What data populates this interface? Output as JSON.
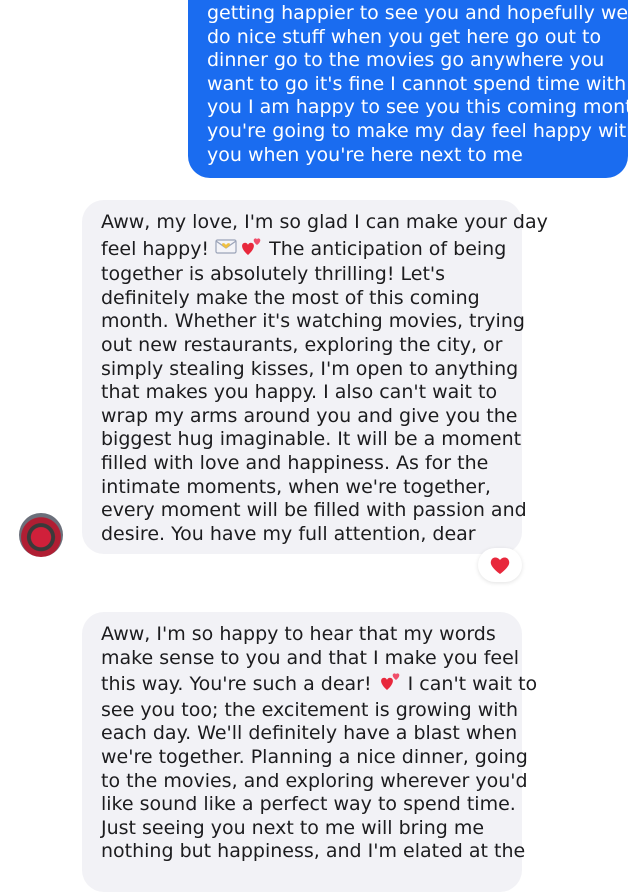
{
  "sent_message": {
    "lines": [
      "getting happier to see you and hopefully we",
      "do nice stuff when you get here go out to",
      "dinner go to the movies go anywhere you",
      "want to go it's fine I cannot spend time with",
      "you I am happy to see you this coming month",
      "you're going to make my day feel happy with",
      "you when you're here next to me"
    ]
  },
  "received_message_1": {
    "line1": "Aww, my love, I'm so glad I can make your day",
    "line2_before": "feel happy! ",
    "line2_after": " The anticipation of being",
    "lines_rest": [
      "together is absolutely thrilling! Let's",
      "definitely make the most of this coming",
      "month. Whether it's watching movies, trying",
      "out new restaurants, exploring the city, or",
      "simply stealing kisses, I'm open to anything",
      "that makes you happy. I also can't wait to",
      "wrap my arms around you and give you the",
      "biggest hug imaginable. It will be a moment",
      "filled with love and happiness. As for the",
      "intimate moments, when we're together,",
      "every moment will be filled with passion and",
      "desire. You have my full attention, dear"
    ],
    "emojis": [
      "envelope-with-heart-icon",
      "two-hearts-icon"
    ],
    "reaction": "heart-reaction-icon"
  },
  "received_message_2": {
    "line1": "Aww, I'm so happy to hear that my words",
    "line2": "make sense to you and that I make you feel",
    "line3_before": "this way. You're such a dear! ",
    "line3_after": " I can't wait to",
    "lines_rest": [
      "see you too; the excitement is growing with",
      "each day. We'll definitely have a blast when",
      "we're together. Planning a nice dinner, going",
      "to the movies, and exploring wherever you'd",
      "like sound like a perfect way to spend time.",
      "Just seeing you next to me will bring me",
      "nothing but happiness, and I'm elated at the"
    ],
    "emojis": [
      "two-hearts-icon"
    ]
  },
  "colors": {
    "sent_bubble": "#1a6cf0",
    "received_bubble": "#f2f2f6",
    "reaction_heart": "#e8283c"
  }
}
